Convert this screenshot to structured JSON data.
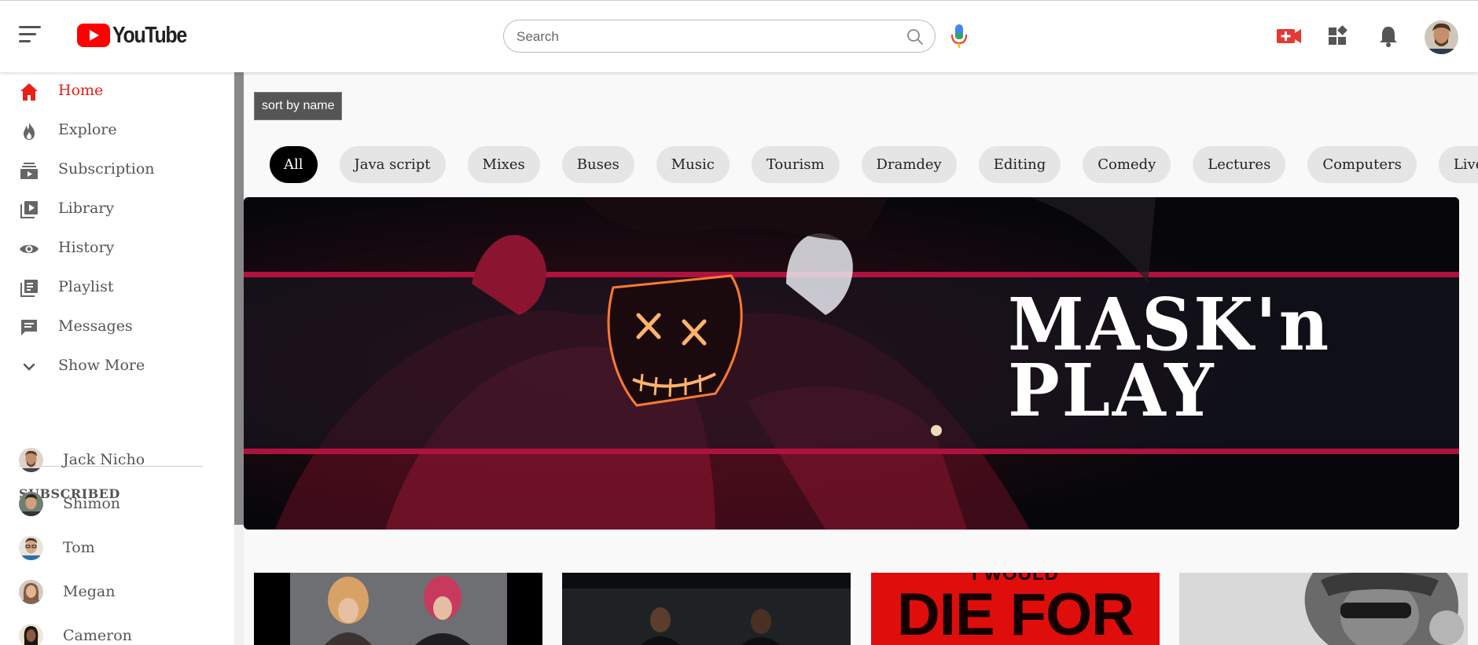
{
  "header": {
    "logo_text": "YouTube",
    "search_placeholder": "Search",
    "icons": [
      "menu-icon",
      "youtube-logo-icon",
      "search-icon",
      "mic-icon",
      "create-video-icon",
      "apps-icon",
      "notifications-icon",
      "user-avatar"
    ],
    "brand_color": "#ff0000"
  },
  "sidebar": {
    "items": [
      {
        "label": "Home",
        "icon": "home-icon",
        "active": true
      },
      {
        "label": "Explore",
        "icon": "fire-icon"
      },
      {
        "label": "Subscription",
        "icon": "subscriptions-icon"
      },
      {
        "label": "Library",
        "icon": "library-icon"
      },
      {
        "label": "History",
        "icon": "eye-icon"
      },
      {
        "label": "Playlist",
        "icon": "playlist-icon"
      },
      {
        "label": "Messages",
        "icon": "message-icon"
      },
      {
        "label": "Show More",
        "icon": "chevron-down-icon"
      }
    ],
    "subscribed_title": "SUBSCRIBED",
    "subscriptions": [
      {
        "name": "Jack Nicho"
      },
      {
        "name": "Shimon"
      },
      {
        "name": "Tom"
      },
      {
        "name": "Megan"
      },
      {
        "name": "Cameron"
      }
    ]
  },
  "main": {
    "sort_button": "sort by name",
    "chips": [
      "All",
      "Java script",
      "Mixes",
      "Buses",
      "Music",
      "Tourism",
      "Dramdey",
      "Editing",
      "Comedy",
      "Lectures",
      "Computers",
      "Live"
    ],
    "active_chip": "All",
    "banner": {
      "line1": "MASK'n",
      "line2": "PLAY"
    },
    "thumbnail_text": {
      "line1": "I WOULD",
      "line2": "DIE FOR"
    }
  }
}
